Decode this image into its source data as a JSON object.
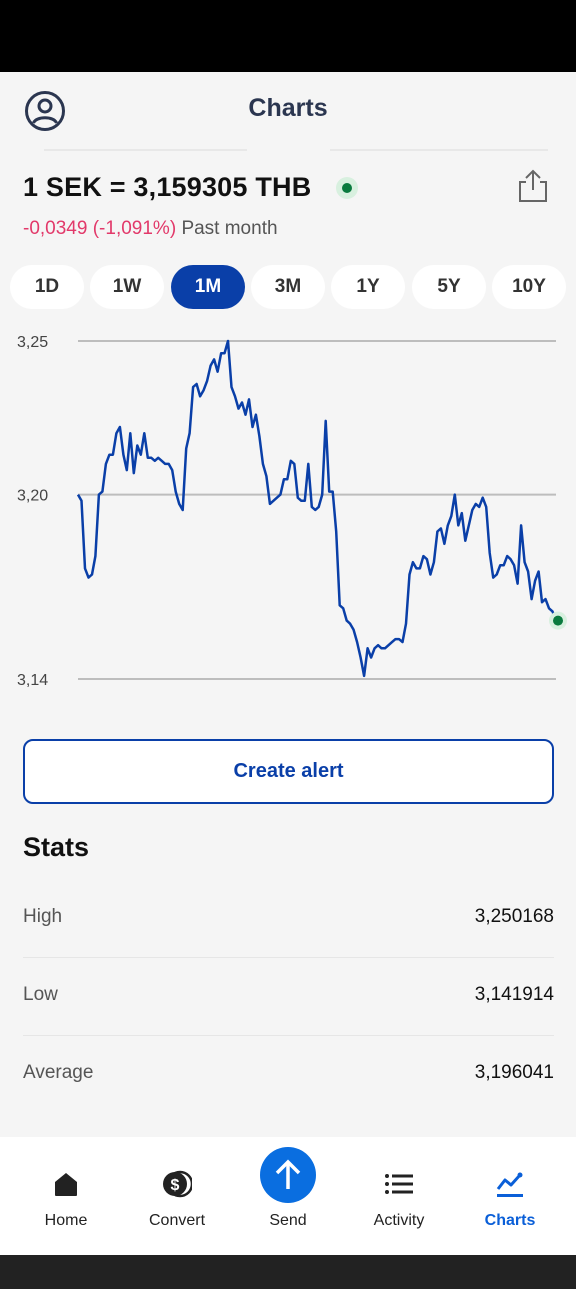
{
  "header": {
    "title": "Charts"
  },
  "rate": {
    "pair_text": "1 SEK = 3,159305 THB",
    "change_text": "-0,0349 (-1,091%)",
    "period_text": "Past month"
  },
  "range_tabs": [
    {
      "label": "1D",
      "active": false
    },
    {
      "label": "1W",
      "active": false
    },
    {
      "label": "1M",
      "active": true
    },
    {
      "label": "3M",
      "active": false
    },
    {
      "label": "1Y",
      "active": false
    },
    {
      "label": "5Y",
      "active": false
    },
    {
      "label": "10Y",
      "active": false
    }
  ],
  "chart_data": {
    "type": "line",
    "title": "",
    "xlabel": "",
    "ylabel": "",
    "ylim": [
      3.14,
      3.25
    ],
    "yticks": [
      "3,25",
      "3,20",
      "3,14"
    ],
    "ytick_values": [
      3.25,
      3.2,
      3.14
    ],
    "grid": true,
    "series": [
      {
        "color": "#0a3fa8",
        "values": [
          3.2,
          3.198,
          3.176,
          3.173,
          3.174,
          3.18,
          3.2,
          3.201,
          3.21,
          3.213,
          3.213,
          3.22,
          3.222,
          3.213,
          3.208,
          3.22,
          3.207,
          3.216,
          3.213,
          3.22,
          3.212,
          3.212,
          3.211,
          3.212,
          3.211,
          3.21,
          3.21,
          3.208,
          3.201,
          3.197,
          3.195,
          3.215,
          3.22,
          3.235,
          3.236,
          3.232,
          3.234,
          3.237,
          3.242,
          3.244,
          3.24,
          3.246,
          3.246,
          3.25,
          3.235,
          3.232,
          3.228,
          3.23,
          3.226,
          3.231,
          3.222,
          3.226,
          3.219,
          3.21,
          3.206,
          3.197,
          3.198,
          3.199,
          3.2,
          3.205,
          3.205,
          3.211,
          3.21,
          3.199,
          3.198,
          3.198,
          3.21,
          3.196,
          3.195,
          3.196,
          3.2,
          3.224,
          3.201,
          3.201,
          3.188,
          3.164,
          3.163,
          3.159,
          3.158,
          3.156,
          3.152,
          3.147,
          3.141,
          3.15,
          3.147,
          3.15,
          3.151,
          3.15,
          3.15,
          3.151,
          3.152,
          3.153,
          3.153,
          3.152,
          3.158,
          3.174,
          3.178,
          3.176,
          3.176,
          3.18,
          3.179,
          3.174,
          3.178,
          3.188,
          3.189,
          3.184,
          3.19,
          3.193,
          3.2,
          3.19,
          3.194,
          3.185,
          3.19,
          3.195,
          3.197,
          3.196,
          3.199,
          3.196,
          3.181,
          3.173,
          3.174,
          3.177,
          3.177,
          3.18,
          3.179,
          3.177,
          3.171,
          3.19,
          3.178,
          3.175,
          3.166,
          3.172,
          3.175,
          3.165,
          3.166,
          3.163,
          3.162,
          3.159
        ]
      }
    ],
    "last_point_marker": true
  },
  "actions": {
    "create_alert": "Create alert"
  },
  "stats": {
    "title": "Stats",
    "rows": [
      {
        "label": "High",
        "value": "3,250168"
      },
      {
        "label": "Low",
        "value": "3,141914"
      },
      {
        "label": "Average",
        "value": "3,196041"
      }
    ]
  },
  "nav": {
    "items": [
      {
        "label": "Home",
        "icon": "home-icon",
        "active": false
      },
      {
        "label": "Convert",
        "icon": "convert-icon",
        "active": false
      },
      {
        "label": "Send",
        "icon": "send-icon",
        "active": false
      },
      {
        "label": "Activity",
        "icon": "activity-icon",
        "active": false
      },
      {
        "label": "Charts",
        "icon": "charts-icon",
        "active": true
      }
    ]
  }
}
